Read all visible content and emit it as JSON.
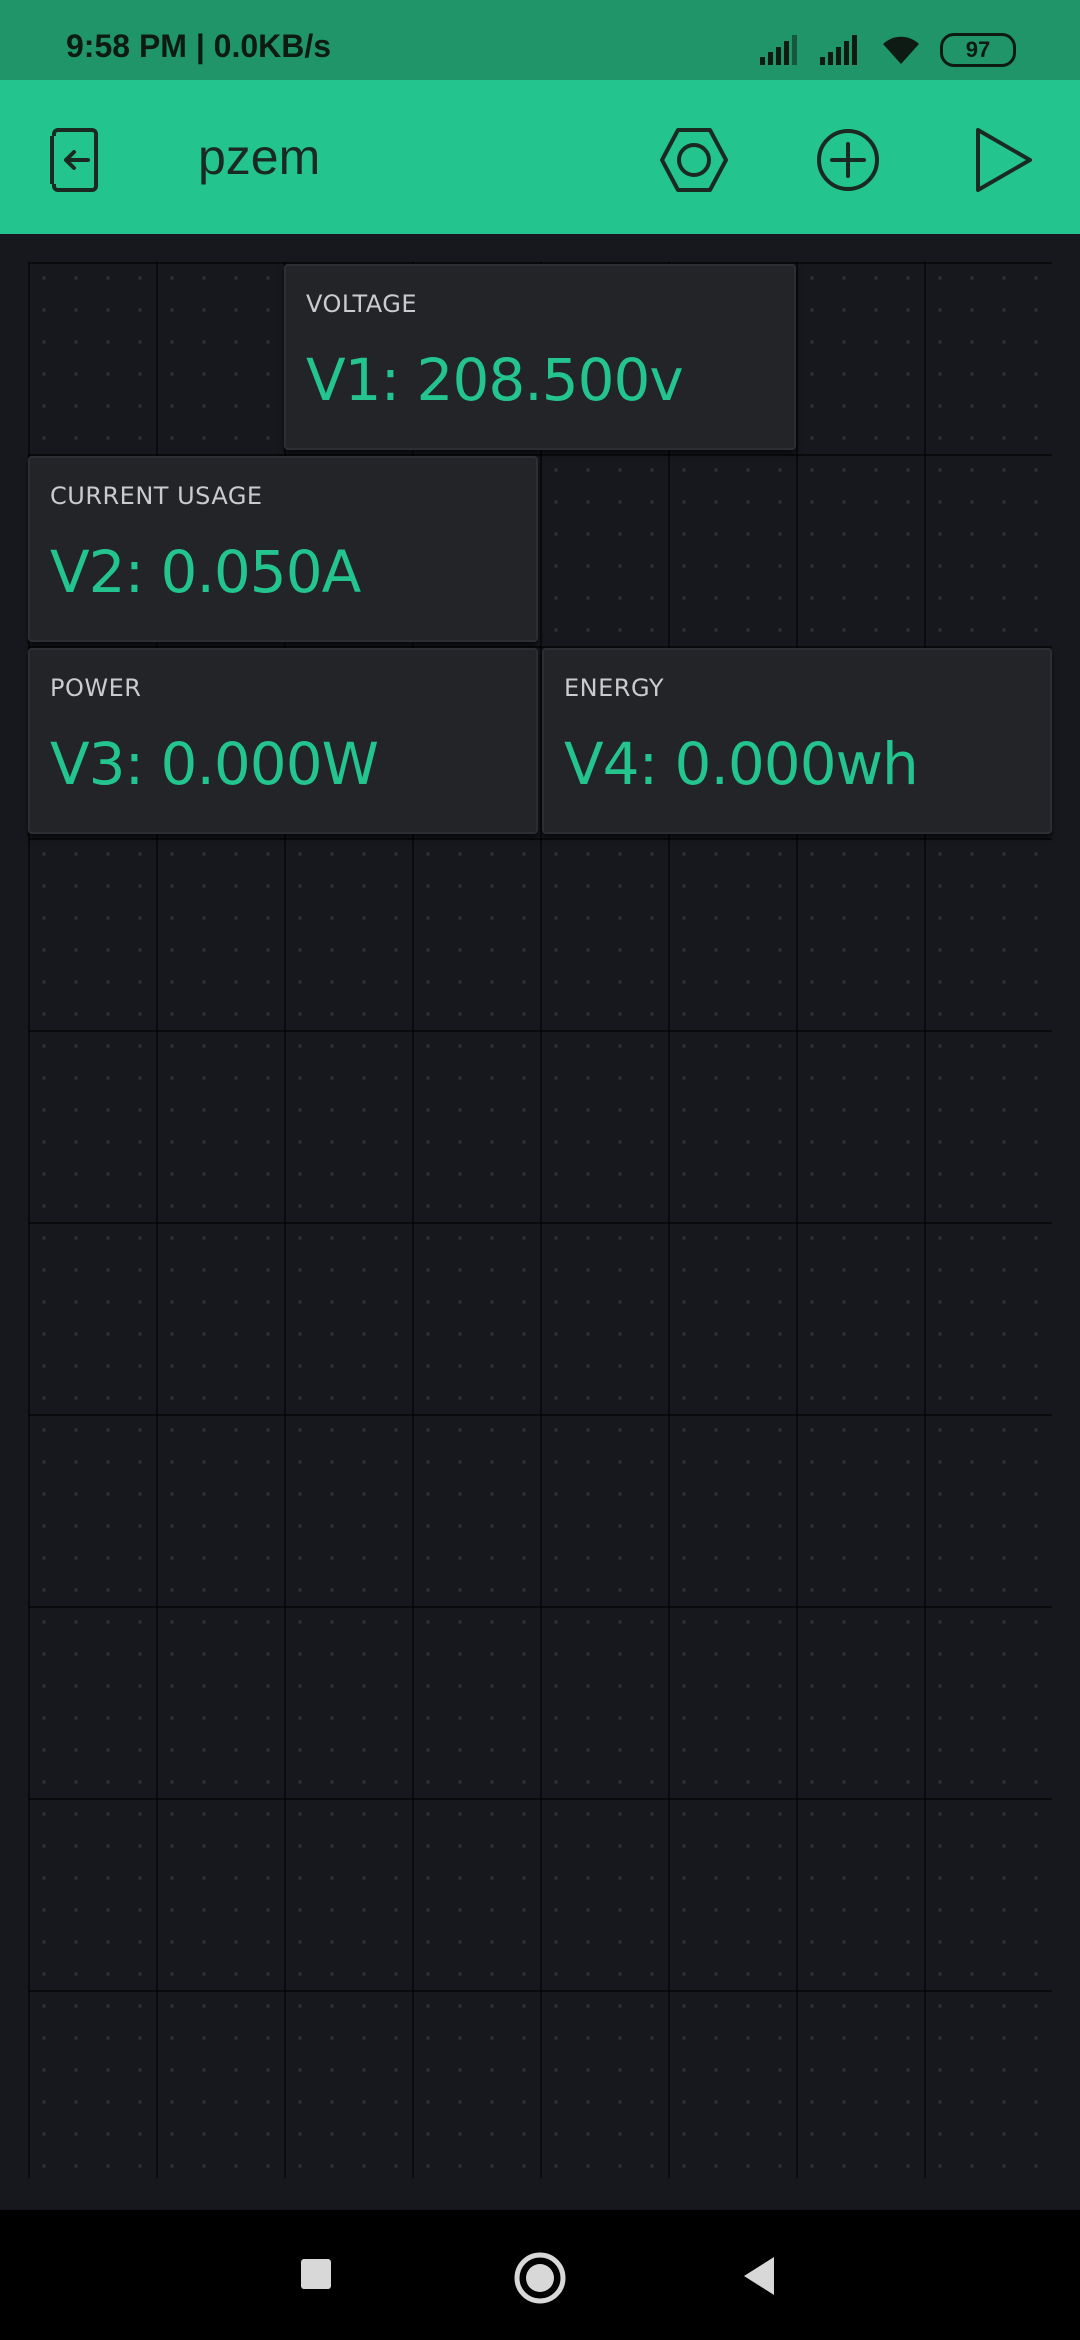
{
  "status_bar": {
    "time": "9:58 PM | 0.0KB/s",
    "battery": "97"
  },
  "header": {
    "title": "pzem",
    "icons": [
      "exit-icon",
      "settings-hex-icon",
      "add-icon",
      "play-icon"
    ]
  },
  "widgets": [
    {
      "label": "VOLTAGE",
      "value": "V1: 208.500v"
    },
    {
      "label": "CURRENT USAGE",
      "value": "V2: 0.050A"
    },
    {
      "label": "POWER",
      "value": "V3: 0.000W"
    },
    {
      "label": "ENERGY",
      "value": "V4: 0.000wh"
    }
  ],
  "nav": {
    "icons": [
      "recents-icon",
      "home-icon",
      "back-icon"
    ]
  },
  "colors": {
    "accent": "#23c48e",
    "status_bar": "#20956a",
    "background": "#17181d",
    "widget_bg": "#222428"
  }
}
